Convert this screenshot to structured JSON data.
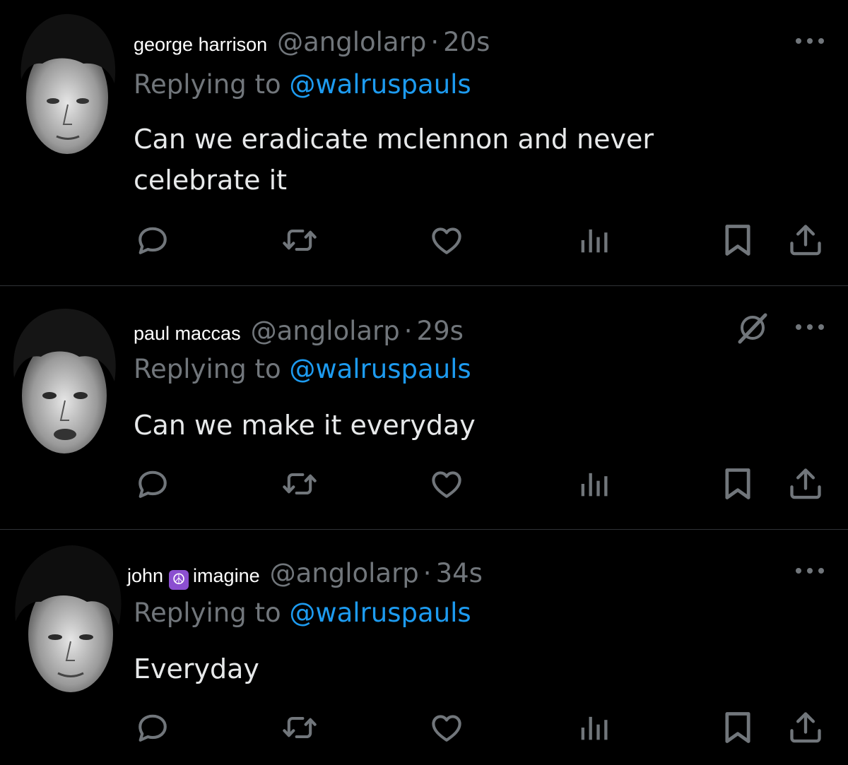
{
  "colors": {
    "background": "#000000",
    "text_primary": "#e7e9ea",
    "text_secondary": "#71767b",
    "accent": "#1d9bf0",
    "divider": "#2f3336",
    "peace_badge": "#8b4fd0"
  },
  "tweets": [
    {
      "display_name": "george harrison",
      "handle": "@anglolarp",
      "separator": "·",
      "time": "20s",
      "replying_prefix": "Replying to",
      "replying_to": "@walruspauls",
      "text": "Can we eradicate mclennon and never celebrate it",
      "avatar_icon": "avatar-photo",
      "actions": [
        "reply-icon",
        "retweet-icon",
        "like-icon",
        "views-icon",
        "bookmark-icon",
        "share-icon"
      ]
    },
    {
      "display_name": "paul maccas",
      "handle": "@anglolarp",
      "separator": "·",
      "time": "29s",
      "replying_prefix": "Replying to",
      "replying_to": "@walruspauls",
      "text": "Can we make it everyday",
      "avatar_icon": "avatar-photo",
      "extra_icon": "grok-off-icon",
      "actions": [
        "reply-icon",
        "retweet-icon",
        "like-icon",
        "views-icon",
        "bookmark-icon",
        "share-icon"
      ]
    },
    {
      "display_name_part1": "john",
      "display_name_emoji": "☮",
      "display_name_part2": "imagine",
      "handle": "@anglolarp",
      "separator": "·",
      "time": "34s",
      "replying_prefix": "Replying to",
      "replying_to": "@walruspauls",
      "text": "Everyday",
      "avatar_icon": "avatar-photo",
      "actions": [
        "reply-icon",
        "retweet-icon",
        "like-icon",
        "views-icon",
        "bookmark-icon",
        "share-icon"
      ]
    }
  ]
}
